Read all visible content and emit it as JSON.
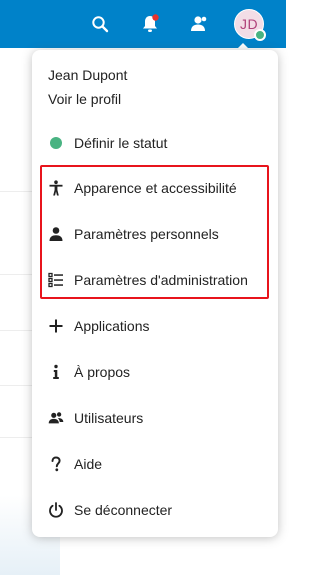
{
  "colors": {
    "header_bg": "#0082c9",
    "status_online": "#49b382",
    "highlight": "#e8141c",
    "notification_dot": "#e9322d"
  },
  "header": {
    "icons": [
      "search-icon",
      "notifications-icon",
      "contacts-icon"
    ],
    "avatar_initials": "JD"
  },
  "menu": {
    "user_name": "Jean Dupont",
    "profile_link": "Voir le profil",
    "items": [
      {
        "label": "Définir le statut",
        "icon": "status-dot-icon"
      },
      {
        "label": "Apparence et accessibilité",
        "icon": "accessibility-icon"
      },
      {
        "label": "Paramètres personnels",
        "icon": "user-icon"
      },
      {
        "label": "Paramètres d'administration",
        "icon": "admin-settings-icon"
      },
      {
        "label": "Applications",
        "icon": "plus-icon"
      },
      {
        "label": "À propos",
        "icon": "info-icon"
      },
      {
        "label": "Utilisateurs",
        "icon": "users-icon"
      },
      {
        "label": "Aide",
        "icon": "help-icon"
      },
      {
        "label": "Se déconnecter",
        "icon": "power-icon"
      }
    ]
  }
}
